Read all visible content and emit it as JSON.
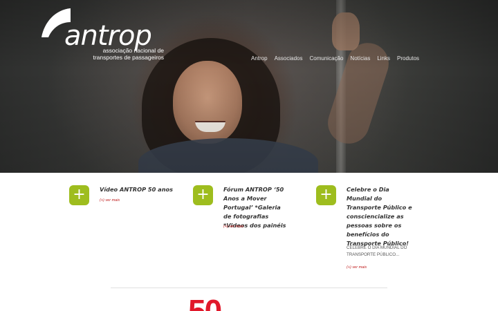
{
  "brand": {
    "name": "antrop",
    "tagline_line1": "associação nacional de",
    "tagline_line2": "transportes de passageiros",
    "accent_color": "#9ebd1e",
    "link_color": "#c02020"
  },
  "nav": {
    "items": [
      "Antrop",
      "Associados",
      "Comunicação",
      "Notícias",
      "Links",
      "Produtos"
    ]
  },
  "news": [
    {
      "icon": "plus-icon",
      "title": "Vídeo ANTROP 50 anos",
      "body": "",
      "more": "(+) ver mais"
    },
    {
      "icon": "plus-icon",
      "title": "Fórum ANTROP ‘50 Anos a Mover Portugal’ *Galeria de fotografias *Videos dos painéis",
      "body": "",
      "more": "(+) ver mais"
    },
    {
      "icon": "plus-icon",
      "title": "Celebre o Dia Mundial do Transporte Público e consciencialize as pessoas sobre os benefícios do Transporte Público!",
      "body": "CELEBRE O DIA MUNDIAL DO TRANSPORTE PÚBLICO...",
      "more": "(+) ver mais"
    }
  ],
  "anniversary": {
    "text": "50",
    "color": "#e1192b"
  }
}
